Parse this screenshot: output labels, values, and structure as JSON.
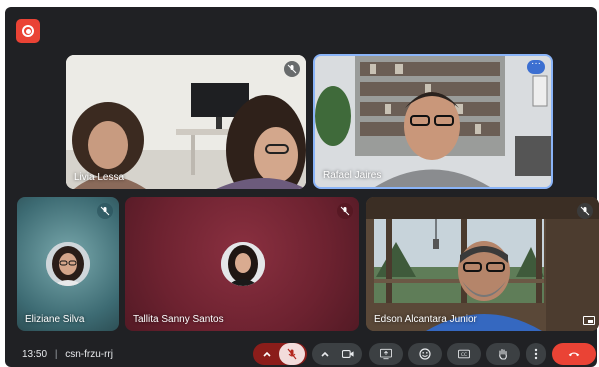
{
  "meeting": {
    "time": "13:50",
    "separator": "|",
    "code": "csn-frzu-rrj"
  },
  "participants": [
    {
      "name": "Livia Lessa"
    },
    {
      "name": "Rafael Jaires"
    },
    {
      "name": "Eliziane Silva"
    },
    {
      "name": "Tallita Sanny Santos"
    },
    {
      "name": "Edson Alcantara Junior"
    }
  ],
  "icons": {
    "record": "record-icon",
    "mic_muted": "mic-off-icon",
    "more": "more-dots-icon",
    "camera": "camera-icon",
    "present": "present-screen-icon",
    "emoji": "emoji-icon",
    "captions": "captions-icon",
    "hand": "raise-hand-icon",
    "options": "more-vert-icon",
    "hangup": "hang-up-icon",
    "pip": "picture-in-picture-icon"
  },
  "colors": {
    "background": "#202124",
    "control": "#3c4043",
    "muted_red": "#8b1d1a",
    "hangup": "#ea4335",
    "active_border": "#8ab4f8",
    "tallita_tile": "#6d2230",
    "eliziane_tile": "#3d6b73"
  }
}
